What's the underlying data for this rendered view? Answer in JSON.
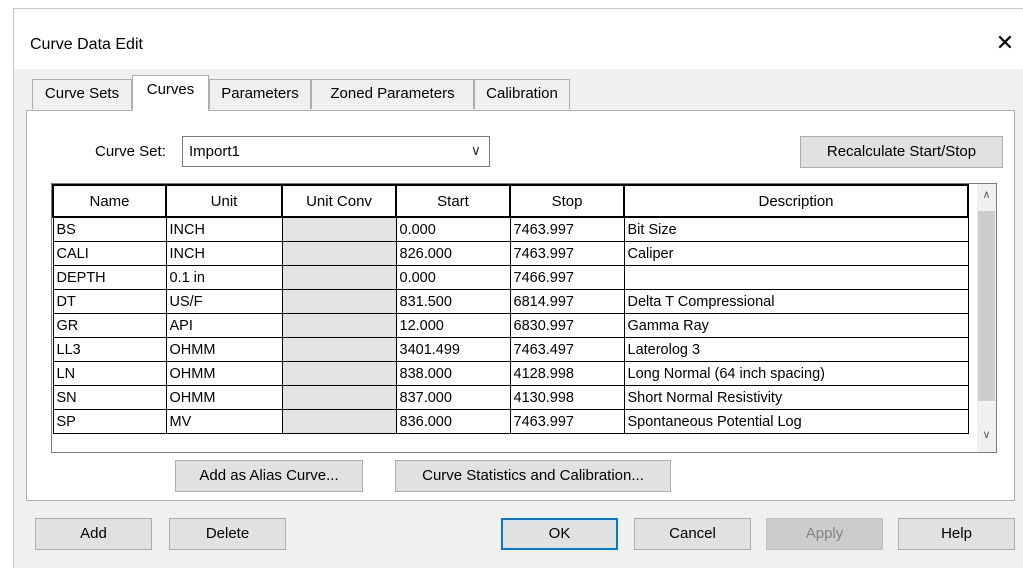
{
  "window": {
    "title": "Curve Data Edit",
    "close_glyph": "✕"
  },
  "tabs": [
    {
      "label": "Curve Sets"
    },
    {
      "label": "Curves"
    },
    {
      "label": "Parameters"
    },
    {
      "label": "Zoned Parameters"
    },
    {
      "label": "Calibration"
    }
  ],
  "active_tab": "Curves",
  "curve_set": {
    "label": "Curve Set:",
    "value": "Import1"
  },
  "buttons": {
    "recalculate": "Recalculate Start/Stop",
    "add_alias": "Add as Alias Curve...",
    "curve_stats": "Curve Statistics and Calibration...",
    "add": "Add",
    "delete": "Delete",
    "ok": "OK",
    "cancel": "Cancel",
    "apply": "Apply",
    "help": "Help"
  },
  "table": {
    "columns": [
      "Name",
      "Unit",
      "Unit Conv",
      "Start",
      "Stop",
      "Description"
    ],
    "rows": [
      [
        "BS",
        "INCH",
        "",
        "0.000",
        "7463.997",
        "Bit Size"
      ],
      [
        "CALI",
        "INCH",
        "",
        "826.000",
        "7463.997",
        "Caliper"
      ],
      [
        "DEPTH",
        "0.1 in",
        "",
        "0.000",
        "7466.997",
        ""
      ],
      [
        "DT",
        "US/F",
        "",
        "831.500",
        "6814.997",
        "Delta T Compressional"
      ],
      [
        "GR",
        "API",
        "",
        "12.000",
        "6830.997",
        "Gamma Ray"
      ],
      [
        "LL3",
        "OHMM",
        "",
        "3401.499",
        "7463.497",
        "Laterolog 3"
      ],
      [
        "LN",
        "OHMM",
        "",
        "838.000",
        "4128.998",
        "Long Normal (64 inch spacing)"
      ],
      [
        "SN",
        "OHMM",
        "",
        "837.000",
        "4130.998",
        "Short Normal Resistivity"
      ],
      [
        "SP",
        "MV",
        "",
        "836.000",
        "7463.997",
        "Spontaneous Potential Log"
      ]
    ]
  },
  "scroll": {
    "up": "∧",
    "down": "∨"
  }
}
